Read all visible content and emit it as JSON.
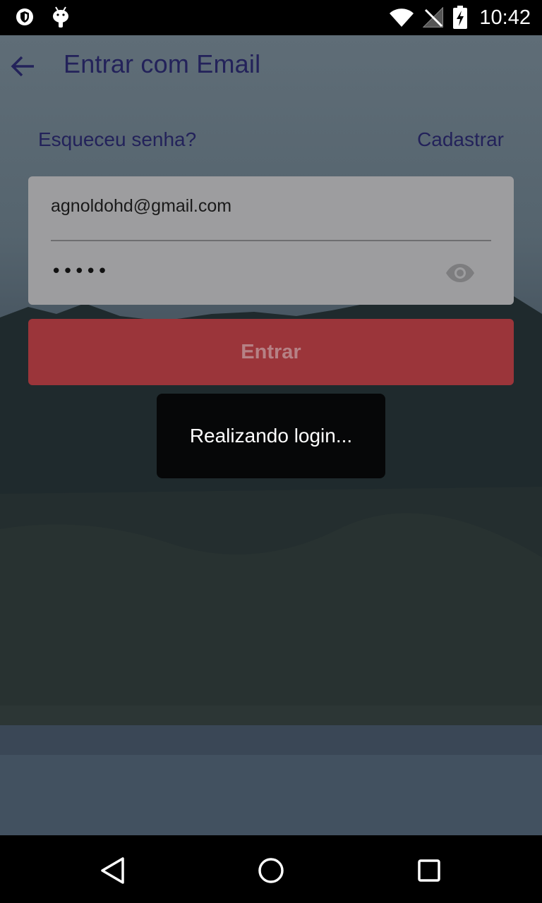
{
  "status_bar": {
    "time": "10:42",
    "icons": [
      "shield-icon",
      "android-icon",
      "wifi-icon",
      "no-signal-icon",
      "battery-charging-icon"
    ]
  },
  "app_bar": {
    "title": "Entrar com Email",
    "back_icon": "arrow-back-icon"
  },
  "links": {
    "forgot_password": "Esqueceu senha?",
    "register": "Cadastrar"
  },
  "form": {
    "email_value": "agnoldohd@gmail.com",
    "password_value": "•••••",
    "visibility_icon": "eye-icon"
  },
  "submit": {
    "label": "Entrar"
  },
  "toast": {
    "message": "Realizando login..."
  },
  "nav_bar": {
    "icons": [
      "triangle-back-icon",
      "circle-home-icon",
      "square-recents-icon"
    ]
  },
  "colors": {
    "title_text": "#23225a",
    "button": "#9b353a",
    "card": "#9d9d9f",
    "toast": "#060708"
  }
}
